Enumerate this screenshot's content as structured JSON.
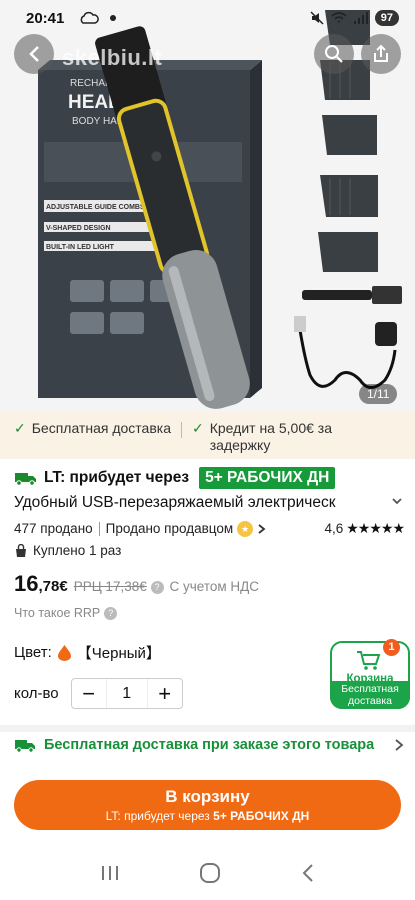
{
  "status_bar": {
    "time": "20:41",
    "battery": "97"
  },
  "gallery": {
    "watermark": "skelbiu.lt",
    "counter": "1/11",
    "box_text": {
      "brand_small": "RECHARGEABLE",
      "brand_big": "HEAD-TO-",
      "brand_sub": "BODY HAIR TRIM",
      "feature_1": "ADJUSTABLE GUIDE COMBS",
      "feature_2": "V-SHAPED DESIGN",
      "feature_3": "BUILT-IN LED LIGHT"
    }
  },
  "promo": {
    "free_delivery": "Бесплатная доставка",
    "credit": "Кредит на 5,00€ за задержку"
  },
  "delivery": {
    "text": "LT: прибудет через",
    "badge": "5+ РАБОЧИХ ДН"
  },
  "product": {
    "title": "Удобный USB-перезаряжаемый электрическ",
    "sold": "477 продано",
    "seller": "Продано продавцом",
    "rating": "4,6",
    "stars": "★★★★★",
    "bought": "Куплено 1 раз"
  },
  "price": {
    "main": "16",
    "cents": ",78€",
    "rrp": "РРЦ 17,38€",
    "vat": "С учетом НДС",
    "rrp_help": "Что такое RRP"
  },
  "options": {
    "color_label": "Цвет:",
    "color_value": "【Черный】",
    "qty_label": "кол-во",
    "qty_value": "1",
    "minus": "−",
    "plus": "+"
  },
  "cart": {
    "count": "1",
    "label": "Корзина",
    "free": "Бесплатная доставка"
  },
  "free_shipping_row": "Бесплатная доставка при заказе этого товара",
  "cta": {
    "main": "В корзину",
    "sub_prefix": "LT: прибудет через ",
    "sub_highlight": "5+ РАБОЧИХ ДН"
  },
  "colors": {
    "accent": "#f06a14",
    "green": "#179b3a",
    "promo_bg": "#fbf2e6"
  }
}
